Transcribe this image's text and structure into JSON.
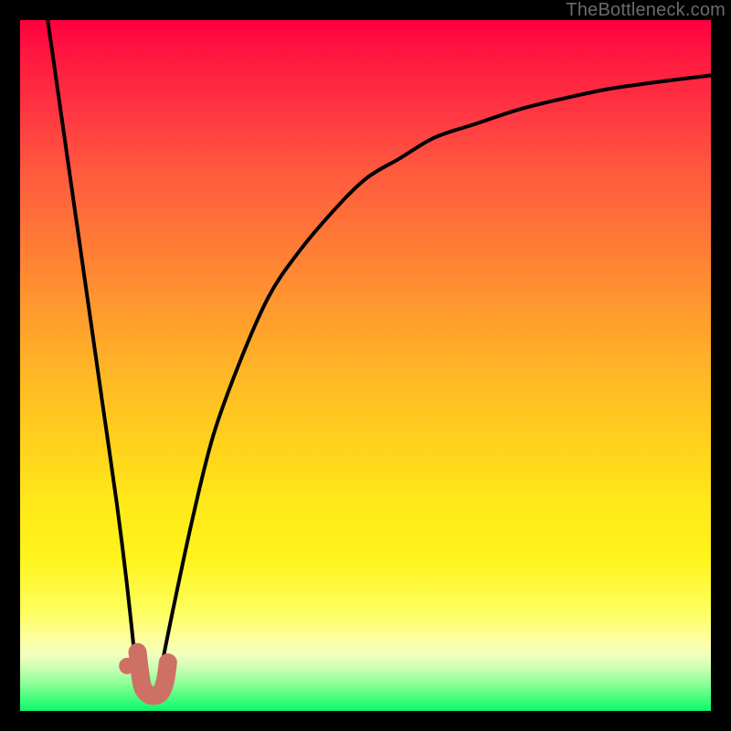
{
  "watermark": {
    "text": "TheBottleneck.com"
  },
  "colors": {
    "frame": "#000000",
    "curve": "#000000",
    "marker": "#cf7065",
    "gradient_top": "#ff003f",
    "gradient_bottom": "#0cf86a"
  },
  "chart_data": {
    "type": "line",
    "title": "",
    "xlabel": "",
    "ylabel": "",
    "xlim": [
      0,
      100
    ],
    "ylim": [
      0,
      100
    ],
    "grid": false,
    "legend": false,
    "series": [
      {
        "name": "left-branch",
        "x": [
          4,
          6,
          8,
          10,
          12,
          14,
          15.5,
          17
        ],
        "values": [
          100,
          86,
          72,
          58,
          44,
          30,
          18,
          4
        ]
      },
      {
        "name": "right-branch",
        "x": [
          20,
          22,
          25,
          28,
          32,
          36,
          40,
          45,
          50,
          55,
          60,
          66,
          72,
          78,
          85,
          92,
          100
        ],
        "values": [
          4,
          14,
          28,
          40,
          51,
          60,
          66,
          72,
          77,
          80,
          83,
          85,
          87,
          88.5,
          90,
          91,
          92
        ]
      }
    ],
    "marker": {
      "name": "highlight-J",
      "dot": {
        "x": 15.5,
        "y": 6.5
      },
      "stroke": [
        {
          "x": 17.0,
          "y": 8.5
        },
        {
          "x": 17.6,
          "y": 4.0
        },
        {
          "x": 18.3,
          "y": 2.6
        },
        {
          "x": 19.3,
          "y": 2.2
        },
        {
          "x": 20.3,
          "y": 2.6
        },
        {
          "x": 21.0,
          "y": 4.3
        },
        {
          "x": 21.4,
          "y": 7.0
        }
      ]
    },
    "background_gradient": {
      "orientation": "vertical",
      "stops": [
        {
          "pos": 0.0,
          "color": "#ff003f"
        },
        {
          "pos": 0.5,
          "color": "#ffc020"
        },
        {
          "pos": 0.8,
          "color": "#fff21a"
        },
        {
          "pos": 1.0,
          "color": "#0cf86a"
        }
      ]
    }
  }
}
